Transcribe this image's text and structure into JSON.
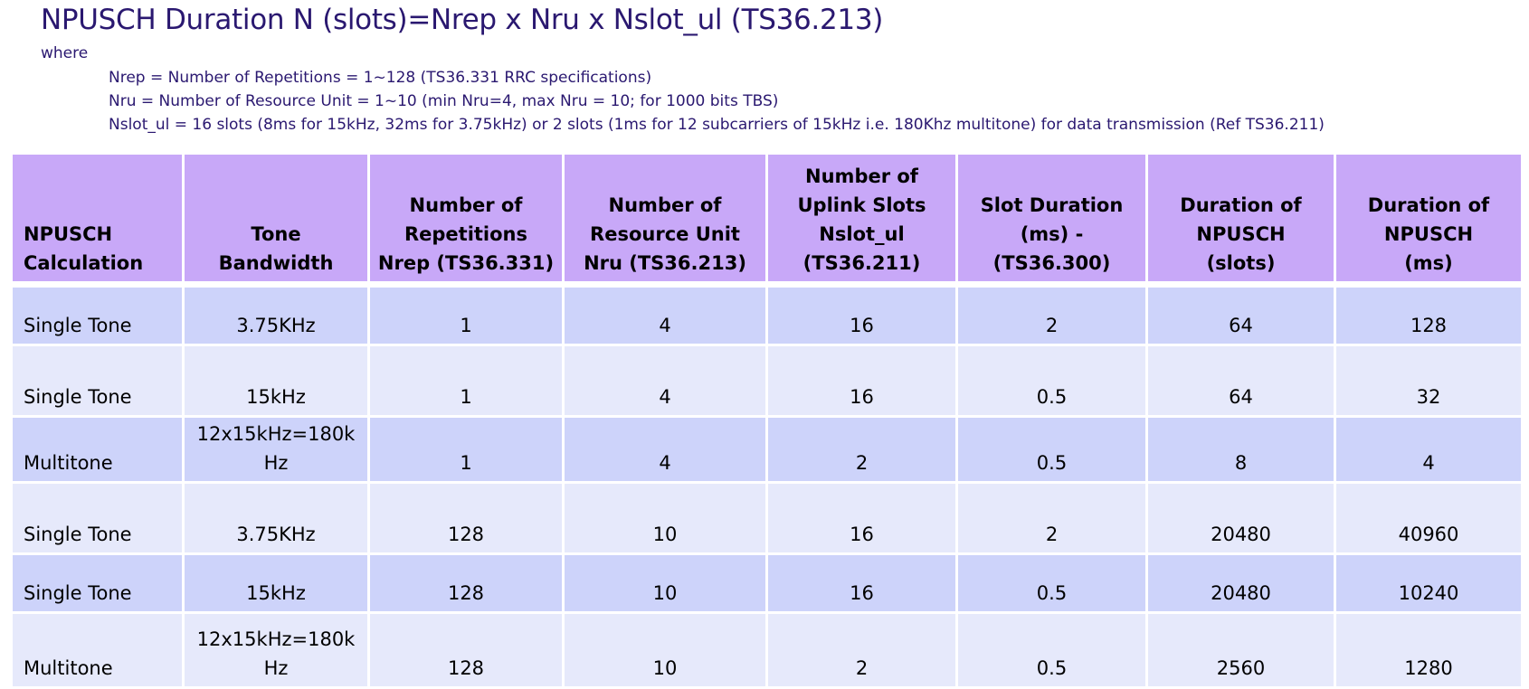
{
  "title": "NPUSCH Duration N (slots)=Nrep x Nru x Nslot_ul  (TS36.213)",
  "where": "where",
  "definitions": [
    "Nrep = Number of Repetitions = 1~128 (TS36.331 RRC specifications)",
    "Nru = Number of Resource Unit = 1~10 (min Nru=4, max Nru = 10; for 1000 bits TBS)",
    "Nslot_ul = 16 slots (8ms for 15kHz, 32ms for 3.75kHz) or 2 slots (1ms for 12 subcarriers of 15kHz i.e. 180Khz multitone) for data transmission (Ref TS36.211)"
  ],
  "table": {
    "header_bg": "#c8a8f8",
    "row_bg_odd": "#cdd3fa",
    "row_bg_even": "#e6e9fb",
    "columns": [
      [
        "NPUSCH",
        "Calculation"
      ],
      [
        "Tone",
        "Bandwidth"
      ],
      [
        "Number of",
        "Repetitions",
        "Nrep (TS36.331)"
      ],
      [
        "Number of",
        "Resource Unit",
        "Nru (TS36.213)"
      ],
      [
        "Number of",
        "Uplink Slots",
        "Nslot_ul",
        "(TS36.211)"
      ],
      [
        "Slot Duration",
        "(ms) -",
        "(TS36.300)"
      ],
      [
        "Duration of",
        "NPUSCH",
        "(slots)"
      ],
      [
        "Duration of",
        "NPUSCH",
        "(ms)"
      ]
    ],
    "rows": [
      {
        "calc": "Single Tone",
        "bw": [
          "3.75KHz"
        ],
        "nrep": "1",
        "nru": "4",
        "nslot": "16",
        "slot_ms": "2",
        "dur_slots": "64",
        "dur_ms": "128"
      },
      {
        "calc": "Single Tone",
        "bw": [
          "15kHz"
        ],
        "nrep": "1",
        "nru": "4",
        "nslot": "16",
        "slot_ms": "0.5",
        "dur_slots": "64",
        "dur_ms": "32"
      },
      {
        "calc": "Multitone",
        "bw": [
          "12x15kHz=180k",
          "Hz"
        ],
        "nrep": "1",
        "nru": "4",
        "nslot": "2",
        "slot_ms": "0.5",
        "dur_slots": "8",
        "dur_ms": "4"
      },
      {
        "calc": "Single Tone",
        "bw": [
          "3.75KHz"
        ],
        "nrep": "128",
        "nru": "10",
        "nslot": "16",
        "slot_ms": "2",
        "dur_slots": "20480",
        "dur_ms": "40960"
      },
      {
        "calc": "Single Tone",
        "bw": [
          "15kHz"
        ],
        "nrep": "128",
        "nru": "10",
        "nslot": "16",
        "slot_ms": "0.5",
        "dur_slots": "20480",
        "dur_ms": "10240"
      },
      {
        "calc": "Multitone",
        "bw": [
          "12x15kHz=180k",
          "Hz"
        ],
        "nrep": "128",
        "nru": "10",
        "nslot": "2",
        "slot_ms": "0.5",
        "dur_slots": "2560",
        "dur_ms": "1280"
      }
    ]
  }
}
